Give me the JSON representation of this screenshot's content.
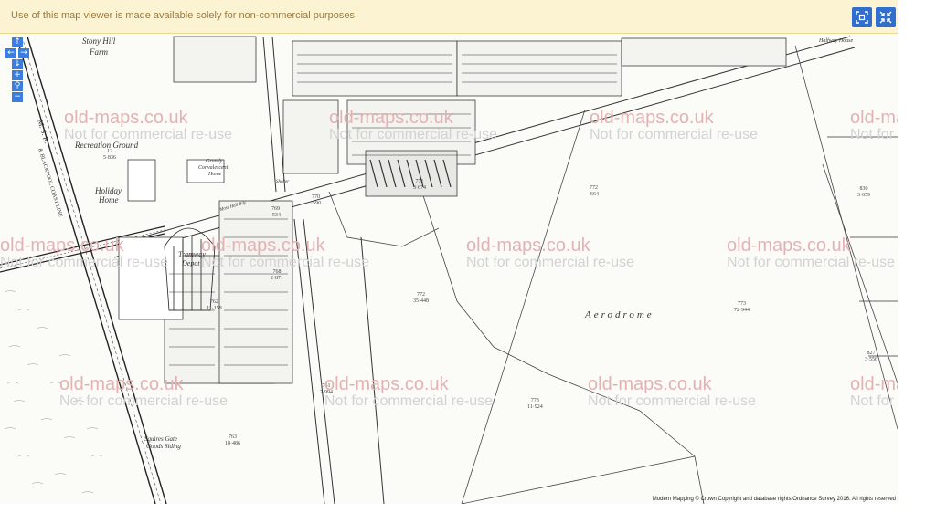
{
  "notice": {
    "text": "Use of this map viewer is made available solely for non-commercial purposes"
  },
  "controls": {
    "icons": [
      "frame-icon",
      "collapse-icon"
    ]
  },
  "nav": {
    "up": "↑",
    "left": "←",
    "right": "→",
    "down": "↓",
    "zoom_in": "+",
    "zoom_mid": "⚲",
    "zoom_out": "−"
  },
  "watermark": {
    "site": "old-maps.co.uk",
    "note": "Not for commercial re-use"
  },
  "labels": {
    "stony_hill": "Stony Hill",
    "farm": "Farm",
    "recreation_ground": "Recreation Ground",
    "holiday_home": "Holiday",
    "holiday_home2": "Home",
    "grundy": "Grundy",
    "convalescent": "Convalescent",
    "home": "Home",
    "tramway_depot": "Tramway",
    "depot": "Depot",
    "aerodrome": "Aerodrome",
    "squires_gate": "Squires Gate",
    "goods_siding": "Goods Siding",
    "halfway_house": "Halfway House",
    "railway": "M. S. R.",
    "coast_line": "& BLACKPOOL COAST LINE",
    "shelter": "Shelter",
    "more_hill_bar": "Moss Hall Bdy"
  },
  "parcels": [
    {
      "num": "772",
      "area": "35·448"
    },
    {
      "num": "773",
      "area": "72·944"
    },
    {
      "num": "773",
      "area": "11·924"
    },
    {
      "num": "772",
      "area": "·664"
    },
    {
      "num": "771",
      "area": "3·674"
    },
    {
      "num": "770",
      "area": "·590"
    },
    {
      "num": "769",
      "area": "·534"
    },
    {
      "num": "768",
      "area": "2·871"
    },
    {
      "num": "762",
      "area": "11·158"
    },
    {
      "num": "761",
      "area": "7·994"
    },
    {
      "num": "763",
      "area": "18·486"
    },
    {
      "num": "12",
      "area": "5·836"
    },
    {
      "num": "830",
      "area": "3·659"
    },
    {
      "num": "827",
      "area": "3·556"
    }
  ],
  "copyright": "Modern Mapping © Crown Copyright and database rights Ordnance Survey 2016. All rights reserved"
}
